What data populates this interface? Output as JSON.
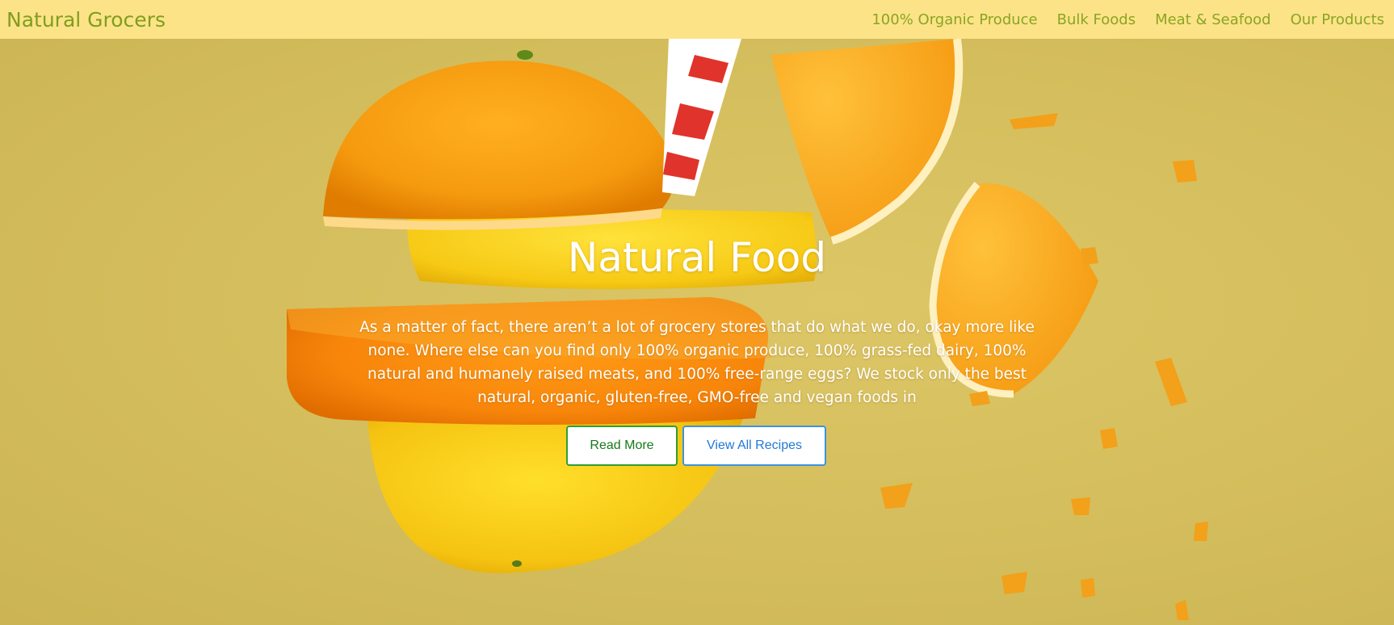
{
  "navbar": {
    "brand": "Natural Grocers",
    "links": [
      {
        "label": "100% Organic Produce"
      },
      {
        "label": "Bulk Foods"
      },
      {
        "label": "Meat & Seafood"
      },
      {
        "label": "Our Products"
      }
    ]
  },
  "hero": {
    "title": "Natural Food",
    "text": "As a matter of fact, there aren’t a lot of grocery stores that do what we do, okay more like none. Where else can you find only 100% organic produce, 100% grass-fed dairy, 100% natural and humanely raised meats, and 100% free-range eggs? We stock only the best natural, organic, gluten-free, GMO-free and vegan foods in",
    "buttons": {
      "read_more": "Read More",
      "view_recipes": "View All Recipes"
    },
    "image": {
      "subject": "stacked orange and lemon slices with striped straw"
    }
  },
  "colors": {
    "navbar_bg": "#fde388",
    "brand_text": "#7f9e1e",
    "hero_bg": "#d5bf5d",
    "read_more_border": "#2e9e33",
    "recipes_border": "#3b93e0"
  }
}
